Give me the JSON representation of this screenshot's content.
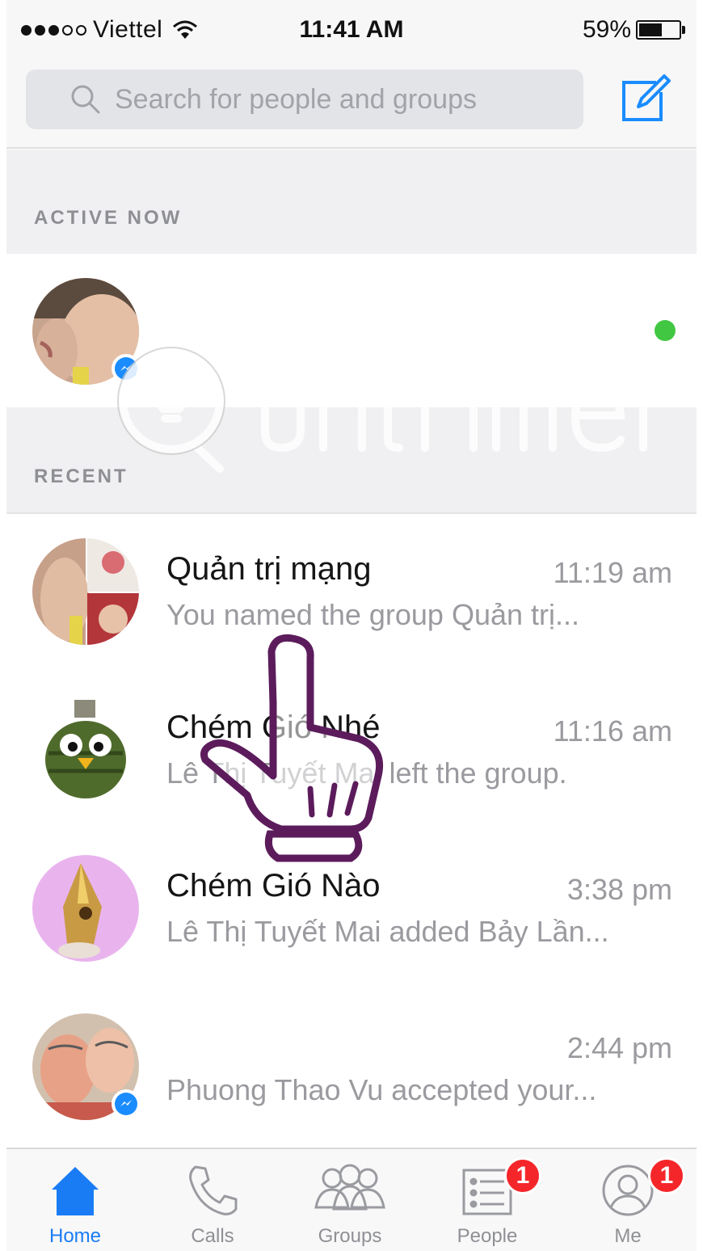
{
  "status_bar": {
    "carrier": "Viettel",
    "time": "11:41 AM",
    "battery": "59%",
    "battery_level": 0.59,
    "signal_bars_filled": 3,
    "signal_bars_total": 5
  },
  "search": {
    "placeholder": "Search for people and groups"
  },
  "icons": {
    "search": "search-icon",
    "compose": "compose-icon",
    "wifi": "wifi-icon",
    "battery": "battery-icon",
    "messenger_badge": "messenger-icon"
  },
  "sections": {
    "active_now": "ACTIVE NOW",
    "recent": "RECENT"
  },
  "active_now": [
    {
      "online": true
    }
  ],
  "conversations": [
    {
      "name": "Quản trị mạng",
      "time": "11:19 am",
      "preview": "You named the group Quản trị..."
    },
    {
      "name": "Chém Gió Nhé",
      "time": "11:16 am",
      "preview": "Lê Thị Tuyết Mai left the group."
    },
    {
      "name": "Chém Gió Nào",
      "time": "3:38 pm",
      "preview": "Lê Thị Tuyết Mai added Bảy Lần..."
    },
    {
      "name": "",
      "time": "2:44 pm",
      "preview": "Phuong Thao Vu accepted your..."
    }
  ],
  "tabs": [
    {
      "label": "Home",
      "active": true
    },
    {
      "label": "Calls",
      "active": false
    },
    {
      "label": "Groups",
      "active": false
    },
    {
      "label": "People",
      "active": false,
      "badge": "1"
    },
    {
      "label": "Me",
      "active": false,
      "badge": "1"
    }
  ],
  "colors": {
    "accent": "#1a7cf5",
    "badge": "#f5262a",
    "online": "#42c742"
  }
}
